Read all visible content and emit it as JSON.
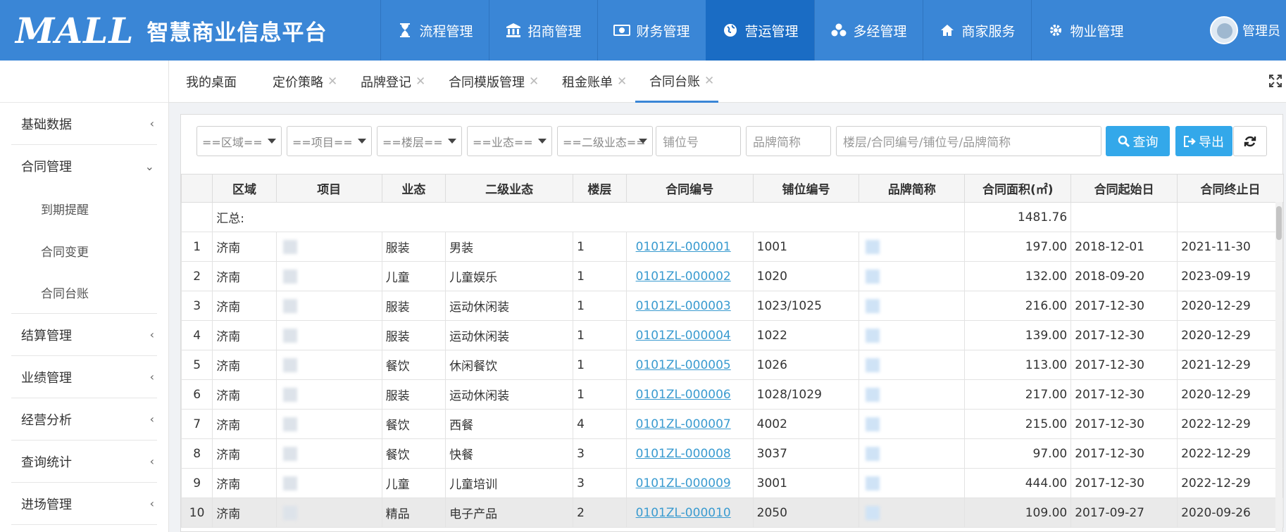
{
  "header": {
    "logo_text": "MALL",
    "title": "智慧商业信息平台",
    "nav": [
      {
        "label": "流程管理",
        "icon": "hourglass-icon"
      },
      {
        "label": "招商管理",
        "icon": "bank-icon"
      },
      {
        "label": "财务管理",
        "icon": "money-icon"
      },
      {
        "label": "营运管理",
        "icon": "globe-icon",
        "active": true
      },
      {
        "label": "多经管理",
        "icon": "cubes-icon"
      },
      {
        "label": "商家服务",
        "icon": "home-icon"
      },
      {
        "label": "物业管理",
        "icon": "gear-icon"
      }
    ],
    "user": "管理员",
    "colors": {
      "header_bg": "#3a86d6",
      "nav_active_bg": "#1a6cc4",
      "button_bg": "#33a8ea",
      "link": "#3a9bd0"
    }
  },
  "sidebar": {
    "items": [
      {
        "label": "基础数据",
        "chevron": "‹"
      },
      {
        "label": "合同管理",
        "chevron": "⌄",
        "expanded": true,
        "children": [
          "到期提醒",
          "合同变更",
          "合同台账"
        ]
      },
      {
        "label": "结算管理",
        "chevron": "‹"
      },
      {
        "label": "业绩管理",
        "chevron": "‹"
      },
      {
        "label": "经营分析",
        "chevron": "‹"
      },
      {
        "label": "查询统计",
        "chevron": "‹"
      },
      {
        "label": "进场管理",
        "chevron": "‹"
      }
    ]
  },
  "tabs": [
    {
      "label": "我的桌面"
    },
    {
      "label": "定价策略",
      "closable": true
    },
    {
      "label": "品牌登记",
      "closable": true
    },
    {
      "label": "合同模版管理",
      "closable": true
    },
    {
      "label": "租金账单",
      "closable": true
    },
    {
      "label": "合同台账",
      "closable": true,
      "active": true
    }
  ],
  "filters": {
    "selects": [
      "==区域==",
      "==项目==",
      "==楼层==",
      "==业态==",
      "==二级业态=="
    ],
    "shop_no_placeholder": "铺位号",
    "brand_placeholder": "品牌简称",
    "keyword_placeholder": "楼层/合同编号/铺位号/品牌简称",
    "search_label": "查询",
    "export_label": "导出"
  },
  "table": {
    "columns": [
      "",
      "区域",
      "项目",
      "业态",
      "二级业态",
      "楼层",
      "合同编号",
      "铺位编号",
      "品牌简称",
      "合同面积(㎡)",
      "合同起始日",
      "合同终止日"
    ],
    "summary_label": "汇总:",
    "summary_area": "1481.76",
    "rows": [
      {
        "idx": "1",
        "region": "济南",
        "format": "服装",
        "subformat": "男装",
        "floor": "1",
        "contract": "0101ZL-000001",
        "shop": "1001",
        "area": "197.00",
        "start": "2018-12-01",
        "end": "2021-11-30"
      },
      {
        "idx": "2",
        "region": "济南",
        "format": "儿童",
        "subformat": "儿童娱乐",
        "floor": "1",
        "contract": "0101ZL-000002",
        "shop": "1020",
        "area": "132.00",
        "start": "2018-09-20",
        "end": "2023-09-19"
      },
      {
        "idx": "3",
        "region": "济南",
        "format": "服装",
        "subformat": "运动休闲装",
        "floor": "1",
        "contract": "0101ZL-000003",
        "shop": "1023/1025",
        "area": "216.00",
        "start": "2017-12-30",
        "end": "2020-12-29"
      },
      {
        "idx": "4",
        "region": "济南",
        "format": "服装",
        "subformat": "运动休闲装",
        "floor": "1",
        "contract": "0101ZL-000004",
        "shop": "1022",
        "area": "139.00",
        "start": "2017-12-30",
        "end": "2020-12-29"
      },
      {
        "idx": "5",
        "region": "济南",
        "format": "餐饮",
        "subformat": "休闲餐饮",
        "floor": "1",
        "contract": "0101ZL-000005",
        "shop": "1026",
        "area": "113.00",
        "start": "2017-12-30",
        "end": "2021-12-29"
      },
      {
        "idx": "6",
        "region": "济南",
        "format": "服装",
        "subformat": "运动休闲装",
        "floor": "1",
        "contract": "0101ZL-000006",
        "shop": "1028/1029",
        "area": "217.00",
        "start": "2017-12-30",
        "end": "2020-12-29"
      },
      {
        "idx": "7",
        "region": "济南",
        "format": "餐饮",
        "subformat": "西餐",
        "floor": "4",
        "contract": "0101ZL-000007",
        "shop": "4002",
        "area": "215.00",
        "start": "2017-12-30",
        "end": "2022-12-29"
      },
      {
        "idx": "8",
        "region": "济南",
        "format": "餐饮",
        "subformat": "快餐",
        "floor": "3",
        "contract": "0101ZL-000008",
        "shop": "3037",
        "area": "97.00",
        "start": "2017-12-30",
        "end": "2022-12-29"
      },
      {
        "idx": "9",
        "region": "济南",
        "format": "儿童",
        "subformat": "儿童培训",
        "floor": "3",
        "contract": "0101ZL-000009",
        "shop": "3001",
        "area": "444.00",
        "start": "2017-12-30",
        "end": "2022-12-29"
      },
      {
        "idx": "10",
        "region": "济南",
        "format": "精品",
        "subformat": "电子产品",
        "floor": "2",
        "contract": "0101ZL-000010",
        "shop": "2050",
        "area": "109.00",
        "start": "2017-09-27",
        "end": "2020-09-26",
        "highlighted": true
      }
    ]
  }
}
